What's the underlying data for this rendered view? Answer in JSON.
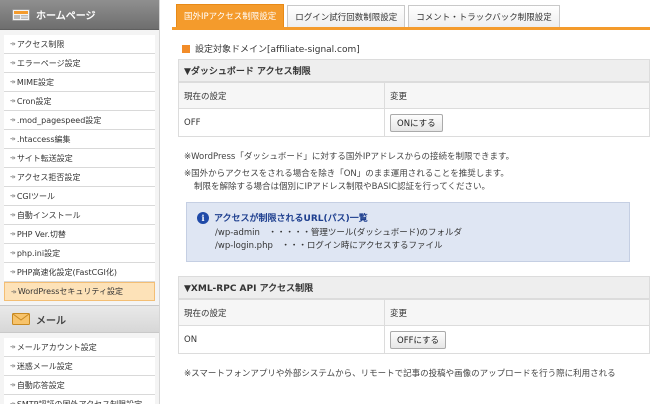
{
  "sidebar": {
    "home_header": "ホームページ",
    "home_items": [
      "アクセス制限",
      "エラーページ設定",
      "MIME設定",
      "Cron設定",
      ".mod_pagespeed設定",
      ".htaccess編集",
      "サイト転送設定",
      "アクセス拒否設定",
      "CGIツール",
      "自動インストール",
      "PHP Ver.切替",
      "php.ini設定",
      "PHP高速化設定(FastCGI化)",
      "WordPressセキュリティ設定"
    ],
    "active_item": "WordPressセキュリティ設定",
    "mail_header": "メール",
    "mail_items": [
      "メールアカウント設定",
      "迷惑メール設定",
      "自動応答設定",
      "SMTP認証の国外アクセス制限設定"
    ]
  },
  "tabs": [
    {
      "label": "国外IPアクセス制限設定",
      "active": true
    },
    {
      "label": "ログイン試行回数制限設定",
      "active": false
    },
    {
      "label": "コメント・トラックバック制限設定",
      "active": false
    }
  ],
  "domain_line": "設定対象ドメイン[affiliate-signal.com]",
  "dashboard": {
    "title": "▼ダッシュボード アクセス制限",
    "col_current": "現在の設定",
    "col_change": "変更",
    "current_value": "OFF",
    "button": "ONにする"
  },
  "notes": {
    "n1": "※WordPress「ダッシュボード」に対する国外IPアドレスからの接続を制限できます。",
    "n2": "※国外からアクセスをされる場合を除き「ON」のまま運用されることを推奨します。",
    "n3": "制限を解除する場合は個別にIPアドレス制限やBASIC認証を行ってください。"
  },
  "info": {
    "title": "アクセスが制限されるURL(パス)一覧",
    "line1": "/wp-admin　・・・・・管理ツール(ダッシュボード)のフォルダ",
    "line2": "/wp-login.php　・・・ログイン時にアクセスするファイル"
  },
  "xmlrpc": {
    "title": "▼XML-RPC API アクセス制限",
    "col_current": "現在の設定",
    "col_change": "変更",
    "current_value": "ON",
    "button": "OFFにする"
  },
  "bottom_note": "※スマートフォンアプリや外部システムから、リモートで記事の投稿や画像のアップロードを行う際に利用される",
  "colors": {
    "accent": "#f49b2c",
    "active_item_bg": "#fde2b8",
    "info_bg": "#dfe6f3",
    "info_title": "#1e3f8f"
  }
}
